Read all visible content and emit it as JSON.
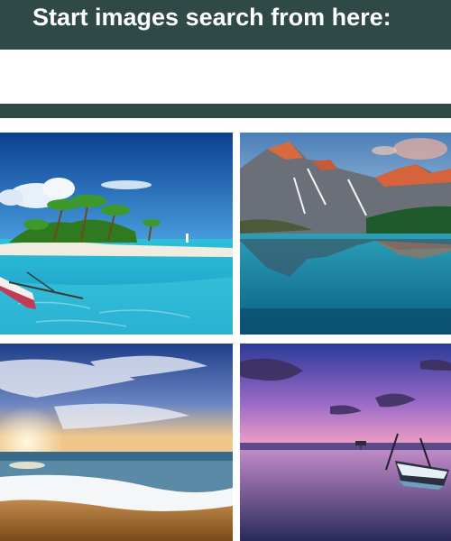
{
  "header": {
    "title": "Start images search from here:",
    "color": "#2f4a46"
  },
  "search": {
    "value": "",
    "placeholder": ""
  },
  "gallery": {
    "images": [
      {
        "name": "tropical-island-image"
      },
      {
        "name": "mountain-lake-image"
      },
      {
        "name": "beach-sunset-image"
      },
      {
        "name": "lake-boat-dusk-image"
      }
    ]
  }
}
